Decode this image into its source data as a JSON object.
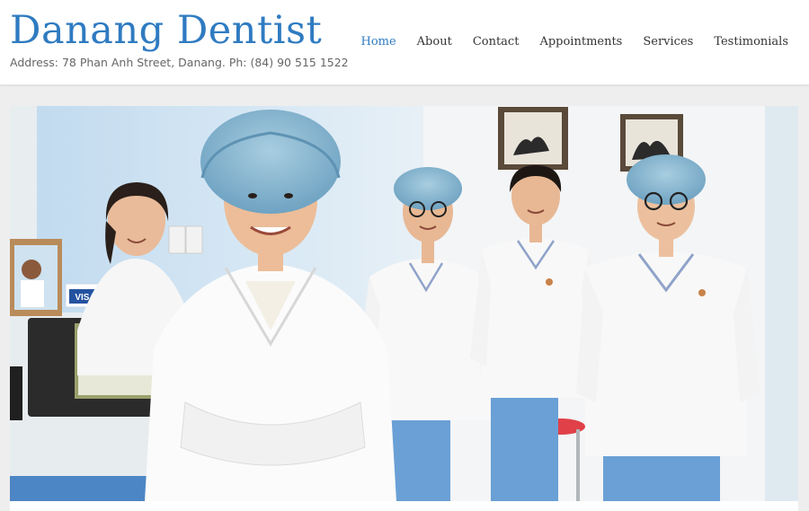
{
  "site": {
    "title": "Danang Dentist",
    "tagline": "Address: 78 Phan Anh Street, Danang. Ph: (84) 90 515 1522"
  },
  "nav": {
    "items": [
      {
        "label": "Home",
        "active": true
      },
      {
        "label": "About",
        "active": false
      },
      {
        "label": "Contact",
        "active": false
      },
      {
        "label": "Appointments",
        "active": false
      },
      {
        "label": "Services",
        "active": false
      },
      {
        "label": "Testimonials",
        "active": false
      }
    ]
  },
  "hero": {
    "image_subject": "dental-team-photo",
    "card_badge": "VISA"
  },
  "colors": {
    "brand": "#2f7bc1",
    "nav_text": "#333333",
    "tagline": "#666666",
    "page_bg": "#eeeeee"
  }
}
